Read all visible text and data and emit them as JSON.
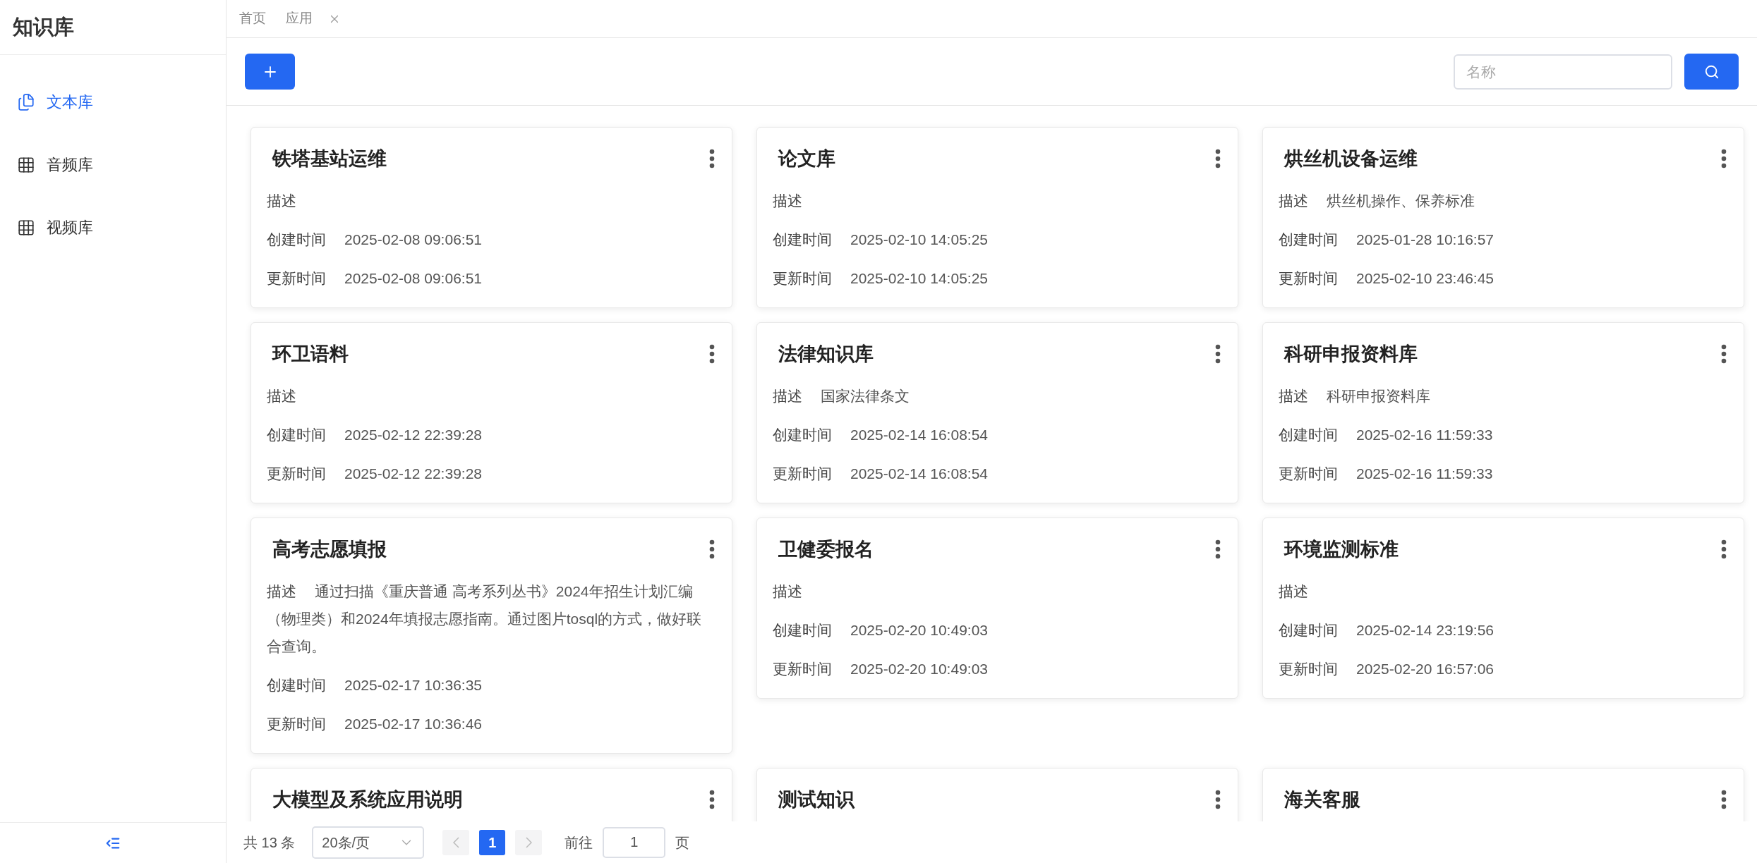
{
  "sidebar": {
    "title": "知识库",
    "items": [
      {
        "label": "文本库",
        "kind": "document",
        "selected": true
      },
      {
        "label": "音频库",
        "kind": "grid",
        "selected": false
      },
      {
        "label": "视频库",
        "kind": "grid",
        "selected": false
      }
    ]
  },
  "tabs": [
    {
      "label": "首页",
      "closable": false
    },
    {
      "label": "应用",
      "closable": true
    }
  ],
  "search": {
    "placeholder": "名称"
  },
  "cards": [
    {
      "title": "铁塔基站运维",
      "fields": [
        {
          "label": "描述"
        },
        {
          "label": "创建时间",
          "value": "2025-02-08 09:06:51"
        },
        {
          "label": "更新时间",
          "value": "2025-02-08 09:06:51"
        }
      ]
    },
    {
      "title": "论文库",
      "fields": [
        {
          "label": "描述"
        },
        {
          "label": "创建时间",
          "value": "2025-02-10 14:05:25"
        },
        {
          "label": "更新时间",
          "value": "2025-02-10 14:05:25"
        }
      ]
    },
    {
      "title": "烘丝机设备运维",
      "fields": [
        {
          "label": "描述",
          "value": "烘丝机操作、保养标准"
        },
        {
          "label": "创建时间",
          "value": "2025-01-28 10:16:57"
        },
        {
          "label": "更新时间",
          "value": "2025-02-10 23:46:45"
        }
      ]
    },
    {
      "title": "环卫语料",
      "fields": [
        {
          "label": "描述"
        },
        {
          "label": "创建时间",
          "value": "2025-02-12 22:39:28"
        },
        {
          "label": "更新时间",
          "value": "2025-02-12 22:39:28"
        }
      ]
    },
    {
      "title": "法律知识库",
      "fields": [
        {
          "label": "描述",
          "value": "国家法律条文"
        },
        {
          "label": "创建时间",
          "value": "2025-02-14 16:08:54"
        },
        {
          "label": "更新时间",
          "value": "2025-02-14 16:08:54"
        }
      ]
    },
    {
      "title": "科研申报资料库",
      "fields": [
        {
          "label": "描述",
          "value": "科研申报资料库"
        },
        {
          "label": "创建时间",
          "value": "2025-02-16 11:59:33"
        },
        {
          "label": "更新时间",
          "value": "2025-02-16 11:59:33"
        }
      ]
    },
    {
      "title": "高考志愿填报",
      "fields": [
        {
          "label": "描述",
          "value": "通过扫描《重庆普通 高考系列丛书》2024年招生计划汇编（物理类）和2024年填报志愿指南。通过图片tosql的方式，做好联合查询。"
        },
        {
          "label": "创建时间",
          "value": "2025-02-17 10:36:35"
        },
        {
          "label": "更新时间",
          "value": "2025-02-17 10:36:46"
        }
      ]
    },
    {
      "title": "卫健委报名",
      "fields": [
        {
          "label": "描述"
        },
        {
          "label": "创建时间",
          "value": "2025-02-20 10:49:03"
        },
        {
          "label": "更新时间",
          "value": "2025-02-20 10:49:03"
        }
      ]
    },
    {
      "title": "环境监测标准",
      "fields": [
        {
          "label": "描述"
        },
        {
          "label": "创建时间",
          "value": "2025-02-14 23:19:56"
        },
        {
          "label": "更新时间",
          "value": "2025-02-20 16:57:06"
        }
      ]
    },
    {
      "title": "大模型及系统应用说明"
    },
    {
      "title": "测试知识"
    },
    {
      "title": "海关客服"
    }
  ],
  "pagination": {
    "total": "共 13 条",
    "page_size": "20条/页",
    "pages": [
      {
        "label": "1",
        "selected": true
      }
    ],
    "goto_label": "前往",
    "goto_value": "1",
    "goto_suffix": "页"
  }
}
